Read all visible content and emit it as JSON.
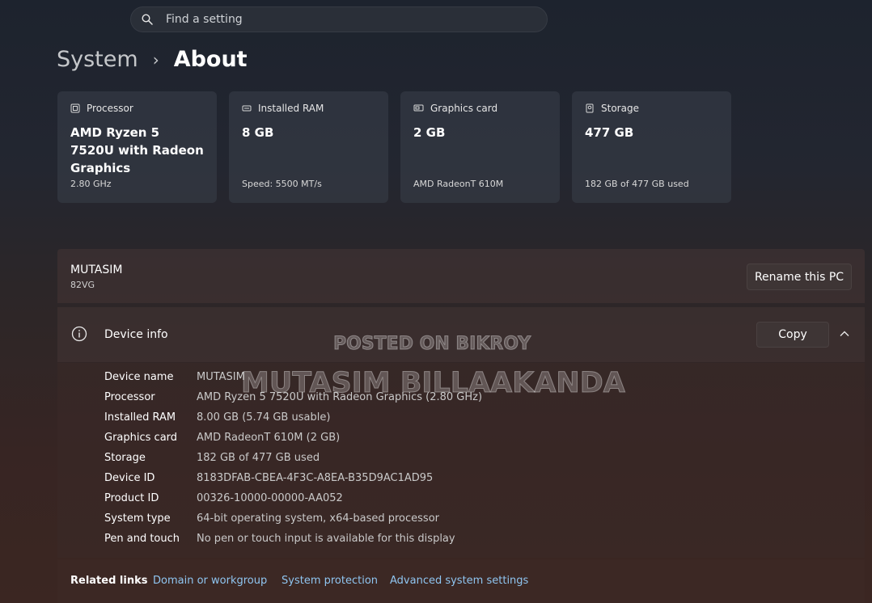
{
  "search": {
    "placeholder": "Find a setting"
  },
  "breadcrumb": {
    "parent": "System",
    "separator": "›",
    "current": "About"
  },
  "specs": [
    {
      "label": "Processor",
      "value": "AMD Ryzen 5 7520U with Radeon Graphics",
      "sub": "2.80 GHz",
      "icon": "cpu-icon"
    },
    {
      "label": "Installed RAM",
      "value": "8 GB",
      "sub": "Speed: 5500 MT/s",
      "icon": "ram-icon"
    },
    {
      "label": "Graphics card",
      "value": "2 GB",
      "sub": "AMD RadeonT 610M",
      "icon": "gpu-icon"
    },
    {
      "label": "Storage",
      "value": "477 GB",
      "sub": "182 GB of 477 GB used",
      "icon": "storage-icon"
    }
  ],
  "pc": {
    "name": "MUTASIM",
    "model": "82VG",
    "rename_label": "Rename this PC"
  },
  "device_info": {
    "title": "Device info",
    "copy_label": "Copy",
    "rows": [
      {
        "key": "Device name",
        "value": "MUTASIM"
      },
      {
        "key": "Processor",
        "value": "AMD Ryzen 5 7520U with Radeon Graphics (2.80 GHz)"
      },
      {
        "key": "Installed RAM",
        "value": "8.00 GB (5.74 GB usable)"
      },
      {
        "key": "Graphics card",
        "value": "AMD RadeonT 610M (2 GB)"
      },
      {
        "key": "Storage",
        "value": "182 GB of 477 GB used"
      },
      {
        "key": "Device ID",
        "value": "8183DFAB-CBEA-4F3C-A8EA-B35D9AC1AD95"
      },
      {
        "key": "Product ID",
        "value": "00326-10000-00000-AA052"
      },
      {
        "key": "System type",
        "value": "64-bit operating system, x64-based processor"
      },
      {
        "key": "Pen and touch",
        "value": "No pen or touch input is available for this display"
      }
    ]
  },
  "related_links": {
    "label": "Related links",
    "items": [
      "Domain or workgroup",
      "System protection",
      "Advanced system settings"
    ]
  },
  "watermark": {
    "line1": "POSTED ON BIKROY",
    "line2": "MUTASIM BILLAAKANDA"
  },
  "colors": {
    "link": "#8fc5f0",
    "accent_text": "#ffffff"
  }
}
